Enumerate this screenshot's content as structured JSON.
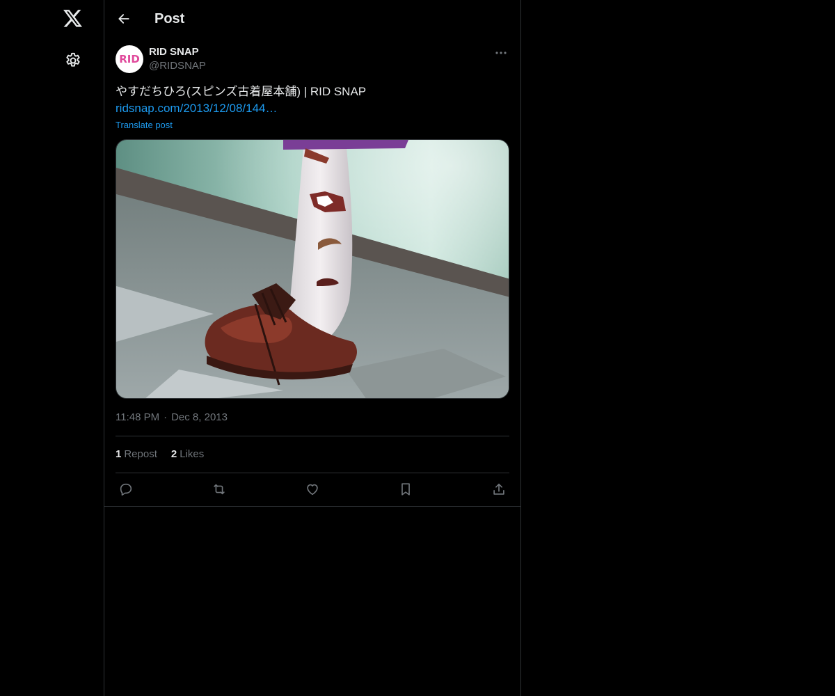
{
  "header": {
    "title": "Post"
  },
  "nav": {
    "logo_icon": "x-logo-icon",
    "settings_icon": "gear-icon"
  },
  "post": {
    "author": {
      "name": "RID SNAP",
      "handle": "@RIDSNAP",
      "avatar_text": "RID",
      "avatar_color": "#e0499b"
    },
    "text": "やすだちひろ(スピンズ古着屋本舗) | RID SNAP",
    "link": "ridsnap.com/2013/12/08/144…",
    "translate_label": "Translate post",
    "time": "11:48 PM",
    "separator": "·",
    "date": "Dec 8, 2013",
    "stats": {
      "reposts_count": "1",
      "reposts_label": "Repost",
      "likes_count": "2",
      "likes_label": "Likes"
    },
    "actions": {
      "reply_icon": "reply-icon",
      "repost_icon": "repost-icon",
      "like_icon": "heart-icon",
      "bookmark_icon": "bookmark-icon",
      "share_icon": "share-icon"
    }
  },
  "colors": {
    "background": "#000000",
    "text": "#e7e9ea",
    "muted": "#71767b",
    "link": "#1d9bf0",
    "border": "#2f3336"
  }
}
